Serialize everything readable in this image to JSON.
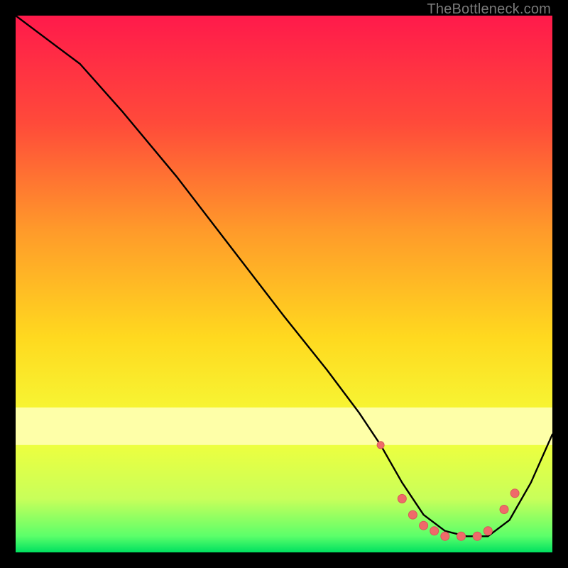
{
  "watermark": "TheBottleneck.com",
  "chart_data": {
    "type": "line",
    "title": "",
    "xlabel": "",
    "ylabel": "",
    "xlim": [
      0,
      100
    ],
    "ylim": [
      0,
      100
    ],
    "grid": false,
    "legend": false,
    "gradient_stops": [
      {
        "offset": 0.0,
        "color": "#ff1a4b"
      },
      {
        "offset": 0.2,
        "color": "#ff4a3a"
      },
      {
        "offset": 0.4,
        "color": "#ff9a2a"
      },
      {
        "offset": 0.6,
        "color": "#ffd91f"
      },
      {
        "offset": 0.78,
        "color": "#f4ff3a"
      },
      {
        "offset": 0.9,
        "color": "#c8ff5a"
      },
      {
        "offset": 0.97,
        "color": "#5bff6a"
      },
      {
        "offset": 1.0,
        "color": "#00e060"
      }
    ],
    "pale_band": {
      "y0": 73,
      "y1": 80,
      "color": "#feffa8"
    },
    "series": [
      {
        "name": "curve",
        "color": "#000000",
        "x": [
          0,
          4,
          8,
          12,
          20,
          30,
          40,
          50,
          58,
          64,
          68,
          72,
          76,
          80,
          84,
          88,
          92,
          96,
          100
        ],
        "y": [
          100,
          97,
          94,
          91,
          82,
          70,
          57,
          44,
          34,
          26,
          20,
          13,
          7,
          4,
          3,
          3,
          6,
          13,
          22
        ]
      }
    ],
    "markers": {
      "color": "#ef6a6a",
      "stroke": "#d85858",
      "points": [
        {
          "x": 68,
          "y": 20,
          "r": 5
        },
        {
          "x": 72,
          "y": 10,
          "r": 6
        },
        {
          "x": 74,
          "y": 7,
          "r": 6
        },
        {
          "x": 76,
          "y": 5,
          "r": 6
        },
        {
          "x": 78,
          "y": 4,
          "r": 6
        },
        {
          "x": 80,
          "y": 3,
          "r": 6
        },
        {
          "x": 83,
          "y": 3,
          "r": 6
        },
        {
          "x": 86,
          "y": 3,
          "r": 6
        },
        {
          "x": 88,
          "y": 4,
          "r": 6
        },
        {
          "x": 91,
          "y": 8,
          "r": 6
        },
        {
          "x": 93,
          "y": 11,
          "r": 6
        }
      ]
    }
  }
}
